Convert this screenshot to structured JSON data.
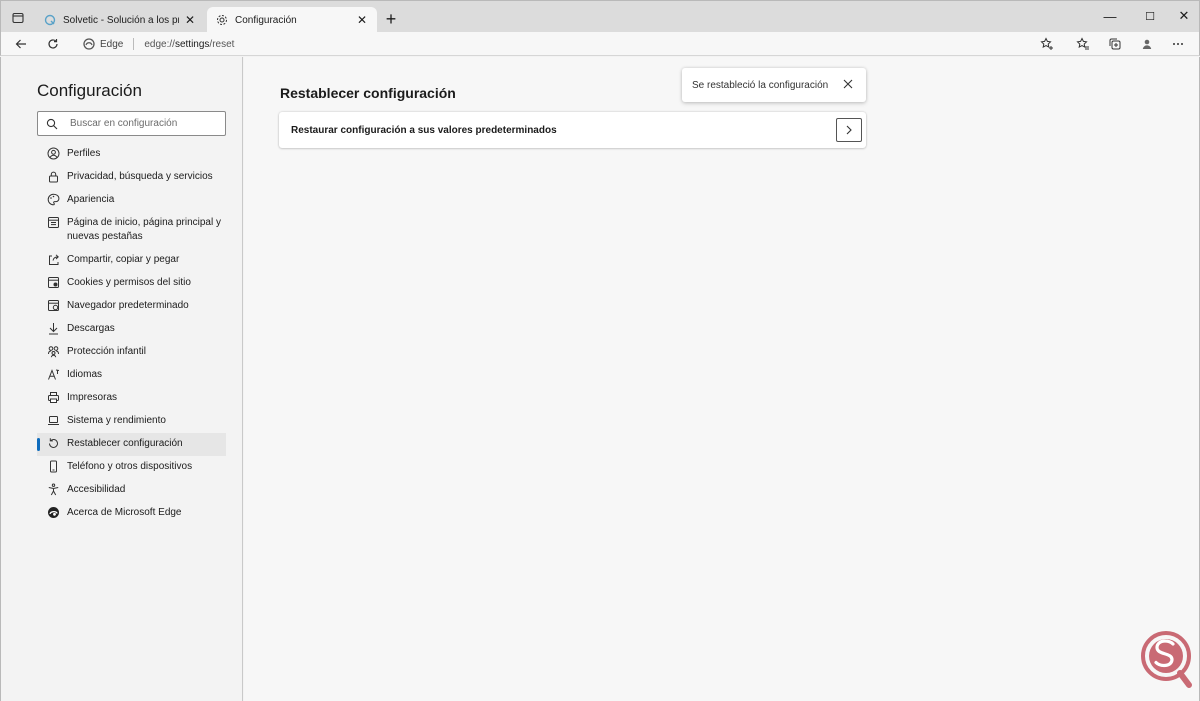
{
  "tabs": [
    {
      "title": "Solvetic - Solución a los problem",
      "active": false
    },
    {
      "title": "Configuración",
      "active": true
    }
  ],
  "window_controls": {
    "minimize": "—",
    "maximize": "☐",
    "close": "✕"
  },
  "address": {
    "site_label": "Edge",
    "url_prefix": "edge://",
    "url_path": "settings",
    "url_suffix": "/reset"
  },
  "sidebar": {
    "title": "Configuración",
    "search_placeholder": "Buscar en configuración",
    "items": [
      {
        "label": "Perfiles",
        "icon": "profile-icon"
      },
      {
        "label": "Privacidad, búsqueda y servicios",
        "icon": "lock-icon"
      },
      {
        "label": "Apariencia",
        "icon": "palette-icon"
      },
      {
        "label": "Página de inicio, página principal y nuevas pestañas",
        "icon": "home-tab-icon"
      },
      {
        "label": "Compartir, copiar y pegar",
        "icon": "share-icon"
      },
      {
        "label": "Cookies y permisos del sitio",
        "icon": "cookie-icon"
      },
      {
        "label": "Navegador predeterminado",
        "icon": "browser-icon"
      },
      {
        "label": "Descargas",
        "icon": "download-icon"
      },
      {
        "label": "Protección infantil",
        "icon": "family-icon"
      },
      {
        "label": "Idiomas",
        "icon": "language-icon"
      },
      {
        "label": "Impresoras",
        "icon": "printer-icon"
      },
      {
        "label": "Sistema y rendimiento",
        "icon": "laptop-icon"
      },
      {
        "label": "Restablecer configuración",
        "icon": "reset-icon",
        "active": true
      },
      {
        "label": "Teléfono y otros dispositivos",
        "icon": "phone-icon"
      },
      {
        "label": "Accesibilidad",
        "icon": "accessibility-icon"
      },
      {
        "label": "Acerca de Microsoft Edge",
        "icon": "edge-icon"
      }
    ]
  },
  "main": {
    "heading": "Restablecer configuración",
    "card_label": "Restaurar configuración a sus valores predeterminados",
    "toast_text": "Se restableció la configuración"
  },
  "colors": {
    "accent": "#0f6cbd",
    "watermark": "#c96a74"
  }
}
